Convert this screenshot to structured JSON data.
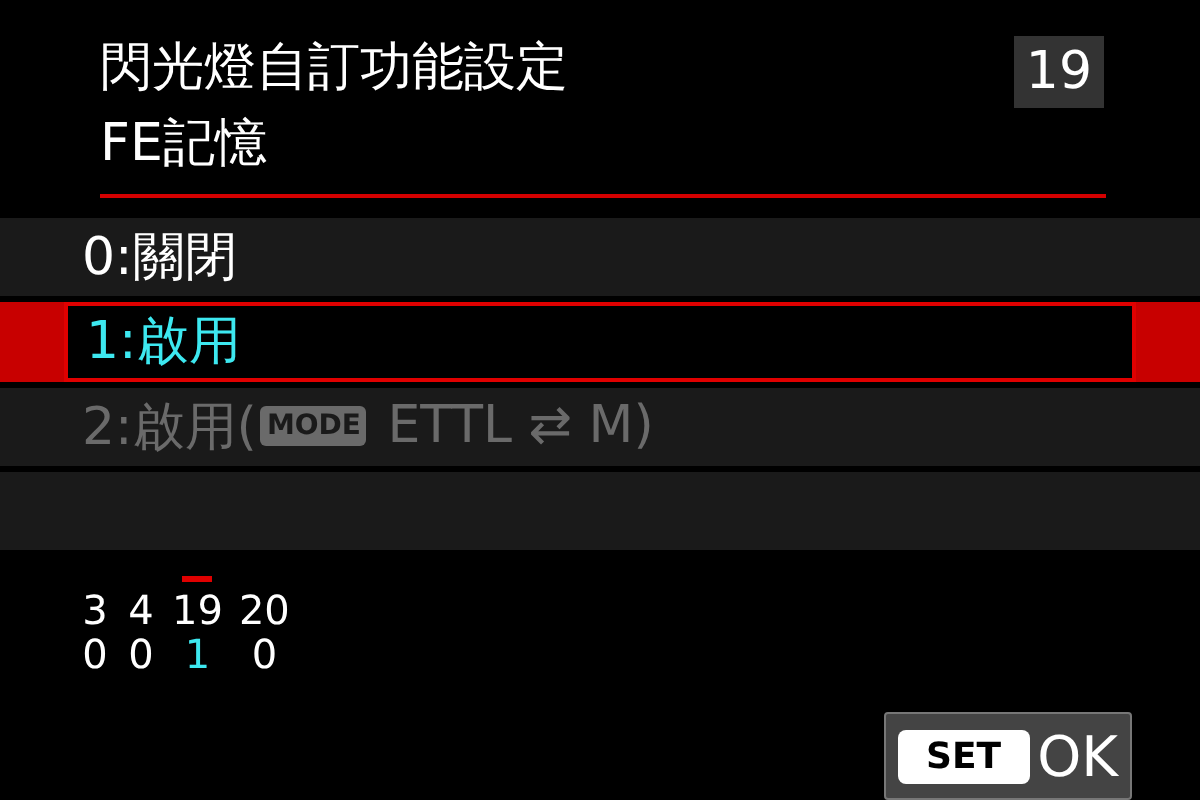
{
  "header": {
    "title": "閃光燈自訂功能設定",
    "subtitle": "FE記憶",
    "page_number": "19"
  },
  "options": [
    {
      "label": "0:關閉",
      "selected": false,
      "disabled": false
    },
    {
      "label": "1:啟用",
      "selected": true,
      "disabled": false
    },
    {
      "label": "2:啟用(",
      "badge": "MODE",
      "suffix": " ETTL ⇄ M)",
      "selected": false,
      "disabled": true
    }
  ],
  "functions": [
    {
      "number": "3",
      "value": "0",
      "selected": false
    },
    {
      "number": "4",
      "value": "0",
      "selected": false
    },
    {
      "number": "19",
      "value": "1",
      "selected": true
    },
    {
      "number": "20",
      "value": "0",
      "selected": false
    }
  ],
  "ok_button": {
    "key": "SET",
    "label": "OK"
  }
}
